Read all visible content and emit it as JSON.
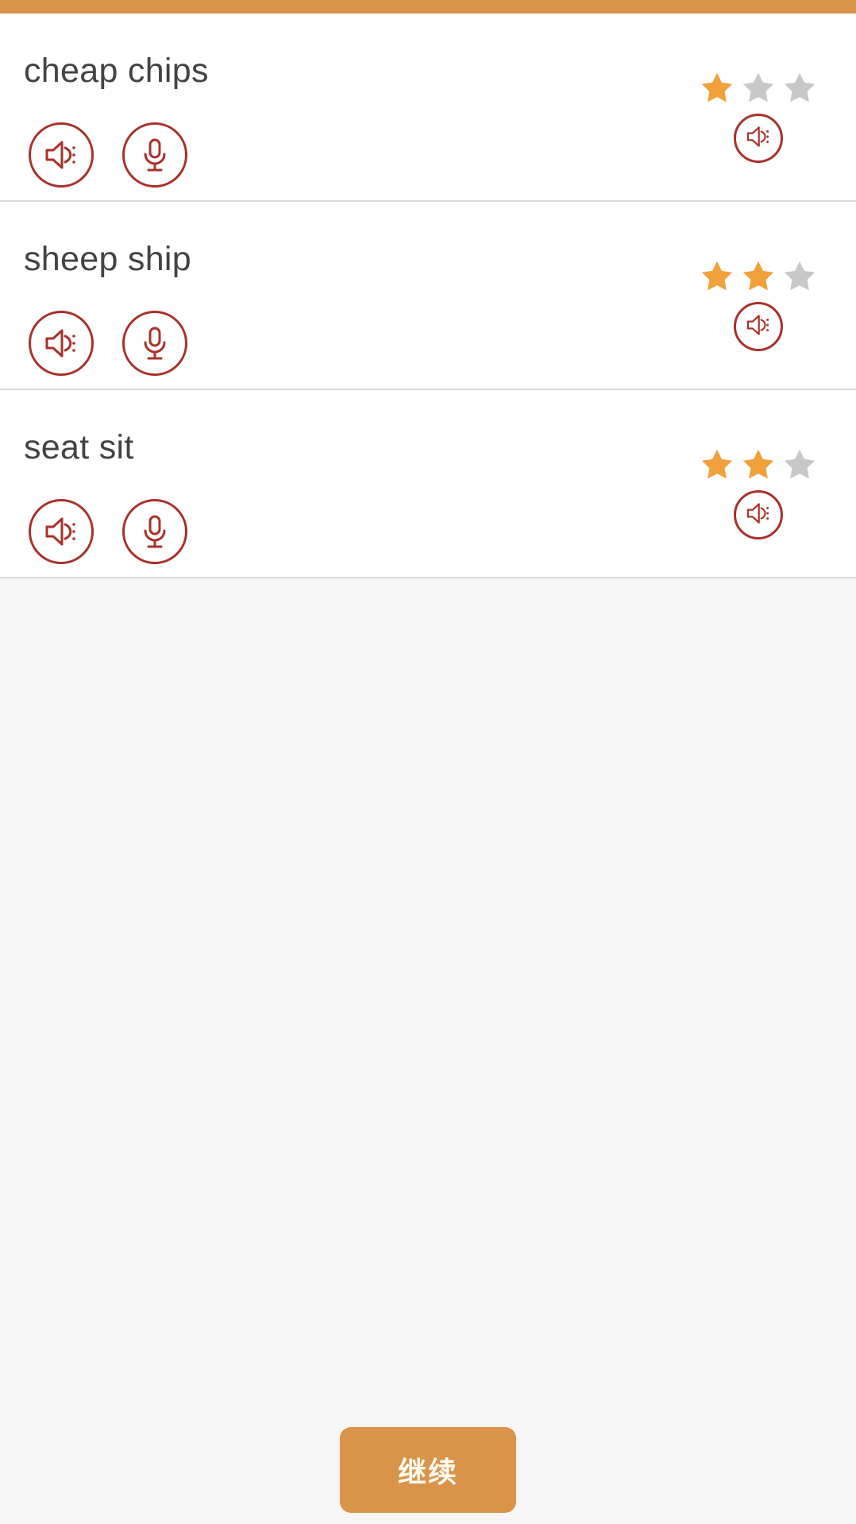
{
  "theme": {
    "accent_orange": "#d9944a",
    "star_filled": "#f0a13c",
    "star_empty": "#c8c8c8",
    "icon_red": "#a8312a",
    "text_dark": "#434343",
    "page_bg": "#f6f6f6",
    "row_bg": "#ffffff"
  },
  "top_bar": {
    "color": "#d9944a"
  },
  "practice_list": {
    "star_total": 3,
    "rows": [
      {
        "word": "cheap chips",
        "stars_filled": 1,
        "listen_icon": "speaker-icon",
        "record_icon": "microphone-icon",
        "playback_icon": "speaker-icon"
      },
      {
        "word": "sheep ship",
        "stars_filled": 2,
        "listen_icon": "speaker-icon",
        "record_icon": "microphone-icon",
        "playback_icon": "speaker-icon"
      },
      {
        "word": "seat sit",
        "stars_filled": 2,
        "listen_icon": "speaker-icon",
        "record_icon": "microphone-icon",
        "playback_icon": "speaker-icon"
      }
    ]
  },
  "footer": {
    "continue_label": "继续"
  }
}
